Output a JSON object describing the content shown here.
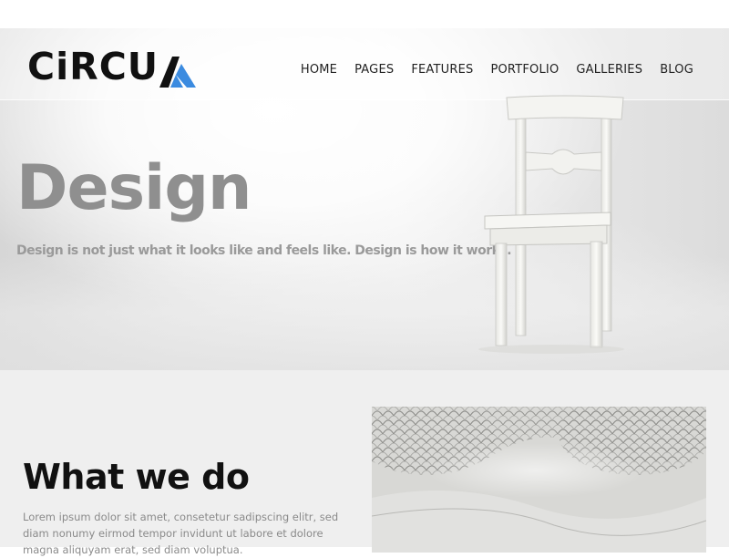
{
  "brand": {
    "logo_text": "CiRCU",
    "logo_mark_colors": {
      "dark": "#111111",
      "accent": "#3b8be0"
    }
  },
  "nav": {
    "items": [
      {
        "label": "HOME"
      },
      {
        "label": "PAGES"
      },
      {
        "label": "FEATURES"
      },
      {
        "label": "PORTFOLIO"
      },
      {
        "label": "GALLERIES"
      },
      {
        "label": "BLOG"
      }
    ]
  },
  "hero": {
    "title": "Design",
    "subtitle": "Design is not just what it looks like and feels like. Design is how it works.",
    "image": "white-chair"
  },
  "section": {
    "title": "What we do",
    "body": "Lorem ipsum dolor sit amet, consetetur sadipscing elitr, sed diam nonumy eirmod tempor invidunt ut labore et dolore magna aliquyam erat, sed diam voluptua.",
    "image": "abstract-mesh"
  },
  "colors": {
    "accent": "#3b8be0",
    "hero_title": "#8f8f8f",
    "content_bg": "#efefef"
  }
}
